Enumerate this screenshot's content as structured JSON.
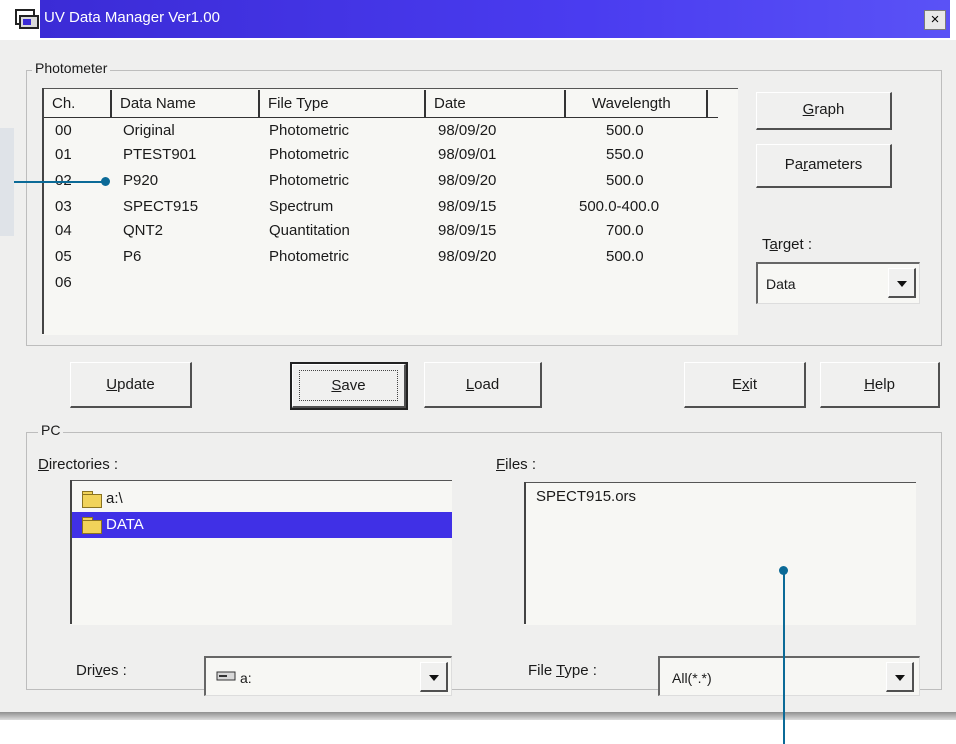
{
  "window": {
    "title": "UV Data Manager Ver1.00",
    "close_label": "×",
    "accent": "#4033e0"
  },
  "photometer": {
    "group_label": "Photometer",
    "columns": [
      "Ch.",
      "Data Name",
      "File Type",
      "Date",
      "Wavelength"
    ],
    "rows": [
      {
        "ch": "00",
        "name": "Original",
        "type": "Photometric",
        "date": "98/09/20",
        "wl": "500.0"
      },
      {
        "ch": "01",
        "name": "PTEST901",
        "type": "Photometric",
        "date": "98/09/01",
        "wl": "550.0"
      },
      {
        "ch": "02",
        "name": "P920",
        "type": "Photometric",
        "date": "98/09/20",
        "wl": "500.0"
      },
      {
        "ch": "03",
        "name": "SPECT915",
        "type": "Spectrum",
        "date": "98/09/15",
        "wl": "500.0-400.0"
      },
      {
        "ch": "04",
        "name": "QNT2",
        "type": "Quantitation",
        "date": "98/09/15",
        "wl": "700.0"
      },
      {
        "ch": "05",
        "name": "P6",
        "type": "Photometric",
        "date": "98/09/20",
        "wl": "500.0"
      },
      {
        "ch": "06",
        "name": "",
        "type": "",
        "date": "",
        "wl": ""
      }
    ],
    "graph_pre": "",
    "graph_ul": "G",
    "graph_post": "raph",
    "params_pre": "Pa",
    "params_ul": "r",
    "params_post": "ameters",
    "target_pre": "T",
    "target_ul": "a",
    "target_post": "rget :",
    "target_value": "Data"
  },
  "actions": {
    "update_pre": "",
    "update_ul": "U",
    "update_post": "pdate",
    "save_pre": "",
    "save_ul": "S",
    "save_post": "ave",
    "load_pre": "",
    "load_ul": "L",
    "load_post": "oad",
    "exit_pre": "E",
    "exit_ul": "x",
    "exit_post": "it",
    "help_pre": "",
    "help_ul": "H",
    "help_post": "elp"
  },
  "pc": {
    "group_label": "PC",
    "dirs_pre": "",
    "dirs_ul": "D",
    "dirs_post": "irectories :",
    "directories": [
      {
        "label": "a:\\",
        "selected": false
      },
      {
        "label": "DATA",
        "selected": true
      }
    ],
    "files_pre": "",
    "files_ul": "F",
    "files_post": "iles :",
    "files": [
      "SPECT915.ors"
    ],
    "drives_pre": "Dri",
    "drives_ul": "v",
    "drives_post": "es :",
    "drive_value": "a:",
    "ftype_pre": "File ",
    "ftype_ul": "T",
    "ftype_post": "ype :",
    "ftype_value": "All(*.*)"
  },
  "colors": {
    "selection": "#4030e6",
    "callout": "#0b6a97"
  }
}
